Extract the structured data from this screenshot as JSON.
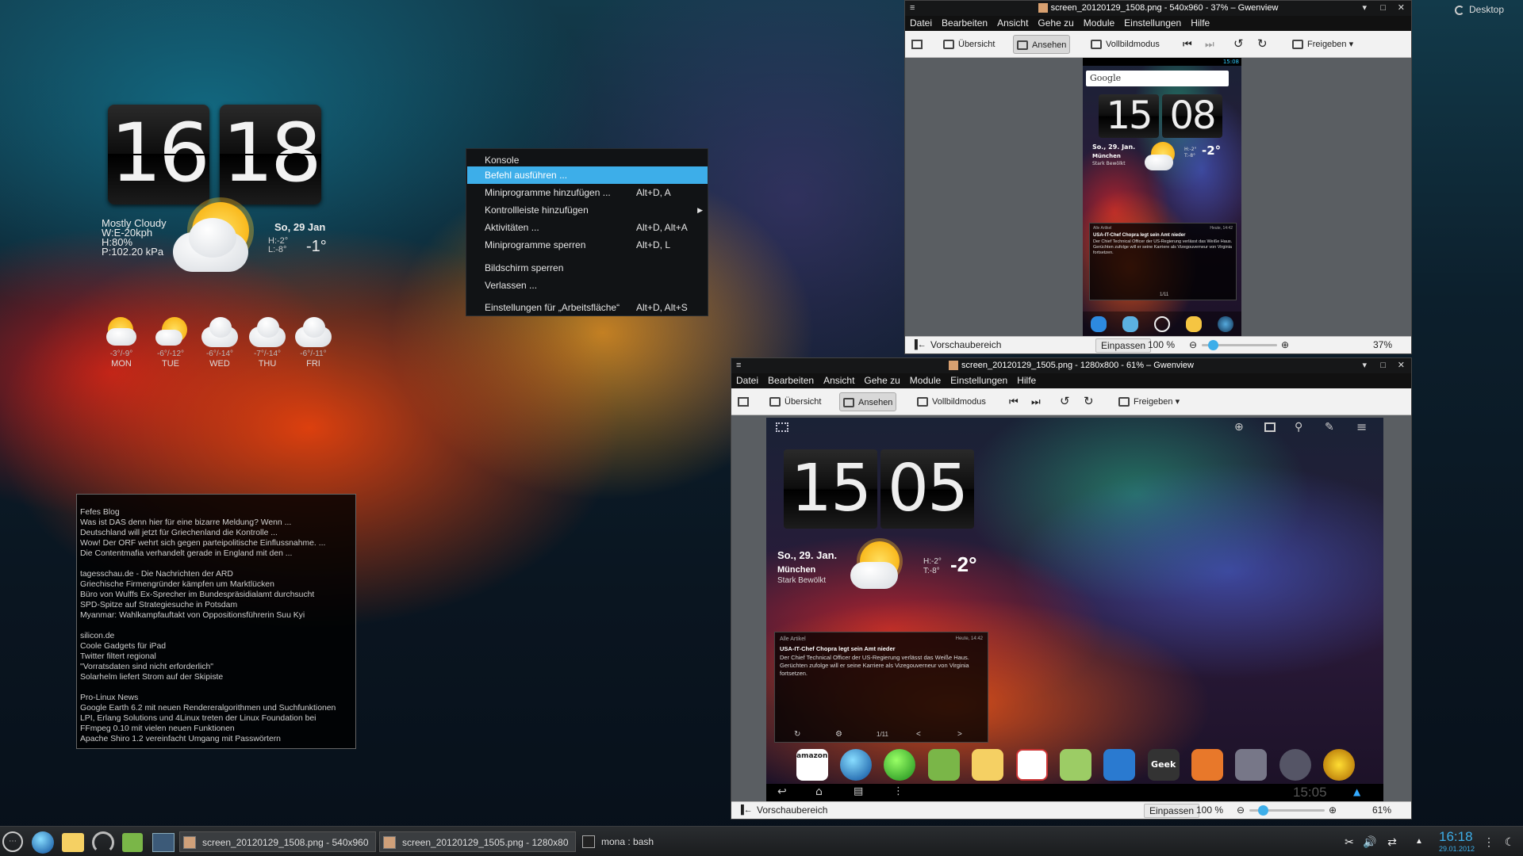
{
  "desktop": {
    "label": "Desktop"
  },
  "clock_widget": {
    "hours": "16",
    "minutes": "18"
  },
  "weather": {
    "condition": "Mostly Cloudy",
    "wind": "W:E-20kph",
    "humidity": "H:80%",
    "pressure": "P:102.20 kPa",
    "date": "So, 29 Jan",
    "high": "H:-2°",
    "low": "L:-8°",
    "current": "-1°",
    "forecast": [
      {
        "day": "MON",
        "temps": "-3°/-9°",
        "icon": "sun-cloud-icon"
      },
      {
        "day": "TUE",
        "temps": "-6°/-12°",
        "icon": "sun-cloud-icon"
      },
      {
        "day": "WED",
        "temps": "-6°/-14°",
        "icon": "cloud-icon"
      },
      {
        "day": "THU",
        "temps": "-7°/-14°",
        "icon": "cloud-icon"
      },
      {
        "day": "FRI",
        "temps": "-6°/-11°",
        "icon": "cloud-icon"
      }
    ]
  },
  "rss": {
    "lines": [
      "Fefes Blog",
      "Was ist DAS denn hier für eine bizarre Meldung?  Wenn ...",
      "Deutschland will jetzt für Griechenland die Kontrolle ...",
      "Wow!  Der ORF wehrt sich gegen parteipolitische Einflussnahme. ...",
      "Die Contentmafia verhandelt gerade in England mit den ...",
      "",
      "tagesschau.de - Die Nachrichten der ARD",
      "Griechische Firmengründer kämpfen um Marktlücken",
      "Büro von Wulffs Ex-Sprecher im Bundespräsidialamt durchsucht",
      "SPD-Spitze auf Strategiesuche in Potsdam",
      "Myanmar: Wahlkampfauftakt von Oppositionsführerin Suu Kyi",
      "",
      "silicon.de",
      "Coole Gadgets für iPad",
      "Twitter filtert regional",
      "\"Vorratsdaten sind nicht erforderlich\"",
      "Solarhelm liefert Strom auf der Skipiste",
      "",
      "Pro-Linux News",
      "Google Earth 6.2 mit neuen Rendereralgorithmen und Suchfunktionen",
      "LPI, Erlang Solutions und 4Linux treten der Linux Foundation bei",
      "FFmpeg 0.10 mit vielen neuen Funktionen",
      "Apache Shiro 1.2 vereinfacht Umgang mit Passwörtern"
    ]
  },
  "context_menu": {
    "items": [
      {
        "label": "Konsole",
        "shortcut": ""
      },
      {
        "label": "Befehl ausführen ...",
        "shortcut": ""
      },
      {
        "label": "Miniprogramme hinzufügen ...",
        "shortcut": "Alt+D, A"
      },
      {
        "label": "Kontrollleiste hinzufügen",
        "shortcut": ""
      },
      {
        "label": "Aktivitäten ...",
        "shortcut": "Alt+D, Alt+A"
      },
      {
        "label": "Miniprogramme sperren",
        "shortcut": "Alt+D, L"
      },
      {
        "label": "Bildschirm sperren",
        "shortcut": ""
      },
      {
        "label": "Verlassen ...",
        "shortcut": ""
      },
      {
        "label": "Einstellungen für „Arbeitsfläche“",
        "shortcut": "Alt+D, Alt+S"
      }
    ]
  },
  "window1": {
    "title": "screen_20120129_1508.png - 540x960 - 37% – Gwenview",
    "menu": [
      "Datei",
      "Bearbeiten",
      "Ansicht",
      "Gehe zu",
      "Module",
      "Einstellungen",
      "Hilfe"
    ],
    "toolbar": {
      "overview": "Übersicht",
      "view": "Ansehen",
      "fullscreen": "Vollbildmodus",
      "share": "Freigeben"
    },
    "status": {
      "preview": "Vorschaubereich",
      "fit": "Einpassen",
      "zoom100": "100 %",
      "zoom": "37%",
      "zoom_fraction": 0.1
    },
    "phone": {
      "google": "Google",
      "statusbar_time": "15:08",
      "hours": "15",
      "minutes": "08",
      "date": "So., 29. Jan.",
      "city": "München",
      "condition": "Stark Bewölkt",
      "high": "H:-2°",
      "low": "T:-8°",
      "temp": "-2°",
      "news_source": "Alle Artikel",
      "news_time": "Heute, 14:42",
      "news_title": "USA-IT-Chef Chopra legt sein Amt nieder",
      "news_body": "Der Chief Technical Officer der US-Regierung verlässt das Weiße Haus. Gerüchten zufolge will er seine Karriere als Vizegouverneur von Virginia fortsetzen.",
      "news_page": "1/11"
    }
  },
  "window2": {
    "title": "screen_20120129_1505.png - 1280x800 - 61% – Gwenview",
    "menu": [
      "Datei",
      "Bearbeiten",
      "Ansicht",
      "Gehe zu",
      "Module",
      "Einstellungen",
      "Hilfe"
    ],
    "toolbar": {
      "overview": "Übersicht",
      "view": "Ansehen",
      "fullscreen": "Vollbildmodus",
      "share": "Freigeben"
    },
    "status": {
      "preview": "Vorschaubereich",
      "fit": "Einpassen",
      "zoom100": "100 %",
      "zoom": "61%",
      "zoom_fraction": 0.13
    },
    "tablet": {
      "hours": "15",
      "minutes": "05",
      "date": "So., 29. Jan.",
      "city": "München",
      "condition": "Stark Bewölkt",
      "high": "H:-2°",
      "low": "T:-8°",
      "temp": "-2°",
      "news_source": "Alle Artikel",
      "news_time": "Heute, 14:42",
      "news_title": "USA-IT-Chef Chopra legt sein Amt nieder",
      "news_body": "Der Chief Technical Officer der US-Regierung verlässt das Weiße Haus. Gerüchten zufolge will er seine Karriere als Vizegouverneur von Virginia fortsetzen.",
      "news_page": "1/11",
      "amazon": "amazon",
      "geek": "Geek",
      "clock": "15:05"
    }
  },
  "taskbar": {
    "tasks": [
      {
        "label": "screen_20120129_1508.png - 540x960"
      },
      {
        "label": "screen_20120129_1505.png - 1280x80"
      },
      {
        "label": "mona : bash"
      }
    ],
    "time": "16:18",
    "date": "29.01.2012"
  }
}
